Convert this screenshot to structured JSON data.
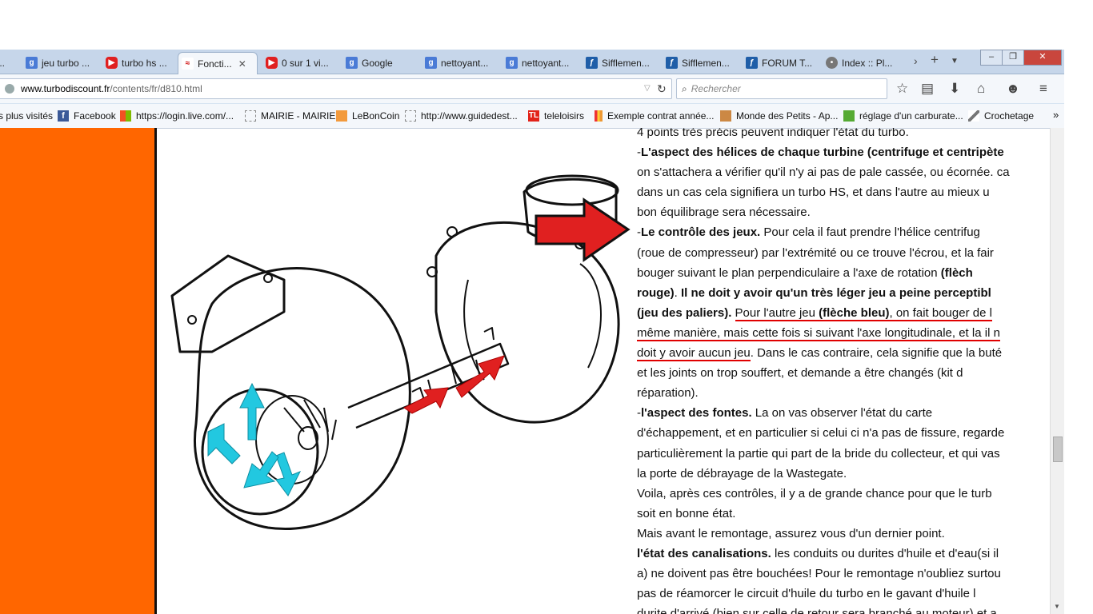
{
  "tabs": [
    {
      "label": "...",
      "icon": "tab-icon"
    },
    {
      "label": "jeu turbo ...",
      "icon": "google-icon"
    },
    {
      "label": "turbo hs ...",
      "icon": "youtube-icon"
    },
    {
      "label": "Foncti...",
      "icon": "turbodiscount-icon",
      "active": true
    },
    {
      "label": "0 sur 1 vi...",
      "icon": "youtube-icon"
    },
    {
      "label": "Google",
      "icon": "google-icon"
    },
    {
      "label": "nettoyant...",
      "icon": "google-icon"
    },
    {
      "label": "nettoyant...",
      "icon": "google-icon"
    },
    {
      "label": "Sifflemen...",
      "icon": "forum-icon"
    },
    {
      "label": "Sifflemen...",
      "icon": "forum-icon"
    },
    {
      "label": "FORUM T...",
      "icon": "forum-icon"
    },
    {
      "label": "Index :: Pl...",
      "icon": "index-icon"
    }
  ],
  "url": {
    "host": "www.turbodiscount.fr",
    "path": "/contents/fr/d810.html"
  },
  "search": {
    "placeholder": "Rechercher"
  },
  "bookmarks": [
    "s plus visités",
    "Facebook",
    "https://login.live.com/...",
    "MAIRIE - MAIRIE",
    "LeBonCoin",
    "http://www.guidedest...",
    "teleloisirs",
    "Exemple contrat année...",
    "Monde des Petits - Ap...",
    "réglage d'un carburate...",
    "Crochetage"
  ],
  "colors": {
    "orange_bar": "#ff6600",
    "arrow_red": "#e02020",
    "arrow_cyan": "#22c8e0",
    "underline": "#e00000"
  },
  "article": {
    "l01": "4 points très précis peuvent indiquer l'état du turbo.",
    "l02a": "-",
    "l02b": "L'aspect des hélices de chaque turbine (centrifuge et centripète",
    "l03": "on s'attachera a vérifier qu'il n'y ai pas de pale cassée, ou écornée. ca",
    "l04": "dans un cas cela signifiera un turbo HS, et dans l'autre au mieux u",
    "l05": "bon équilibrage sera nécessaire.",
    "l06a": "-",
    "l06b": "Le contrôle des jeux.",
    "l06c": " Pour cela il faut prendre l'hélice centrifug",
    "l07": "(roue de compresseur) par l'extrémité ou ce trouve l'écrou, et la fair",
    "l08a": "bouger suivant le plan perpendiculaire a l'axe de rotation ",
    "l08b": "(flèch",
    "l09a": "rouge)",
    "l09b": ". ",
    "l09c": "Il ne doit y avoir qu'un très léger jeu a peine perceptibl",
    "l10a": "(jeu des paliers).",
    "l10b": " ",
    "l10c": "Pour l'autre jeu ",
    "l10d": "(flèche bleu)",
    "l10e": ", on fait bouger de l",
    "l11": "même manière, mais cette fois si suivant l'axe longitudinale, et la il n",
    "l12a": "doit y avoir aucun jeu",
    "l12b": ". Dans le cas contraire, cela signifie que la buté",
    "l13": "et les joints on trop souffert, et demande a être changés (kit d",
    "l14": "réparation).",
    "l15a": "-",
    "l15b": "l'aspect des fontes.",
    "l15c": " La on vas observer l'état du carte",
    "l16": "d'échappement, et en particulier si celui ci n'a pas de fissure, regarde",
    "l17": "particulièrement la partie qui part de la bride du collecteur, et qui vas",
    "l18": "la porte de débrayage de la Wastegate.",
    "l19": "Voila, après ces contrôles, il y a de grande chance pour que le turb",
    "l20": "soit en bonne état.",
    "l21": "Mais avant le remontage, assurez vous d'un dernier point.",
    "l22a": "l'état des canalisations.",
    "l22b": " les conduits ou durites d'huile et d'eau(si il",
    "l23": "a) ne doivent pas être bouchées! Pour le remontage n'oubliez surtou",
    "l24": "pas de réamorcer le circuit d'huile du turbo en le gavant d'huile l",
    "l25": "durite d'arrivé (bien sur celle de retour sera branché au moteur) et a"
  }
}
